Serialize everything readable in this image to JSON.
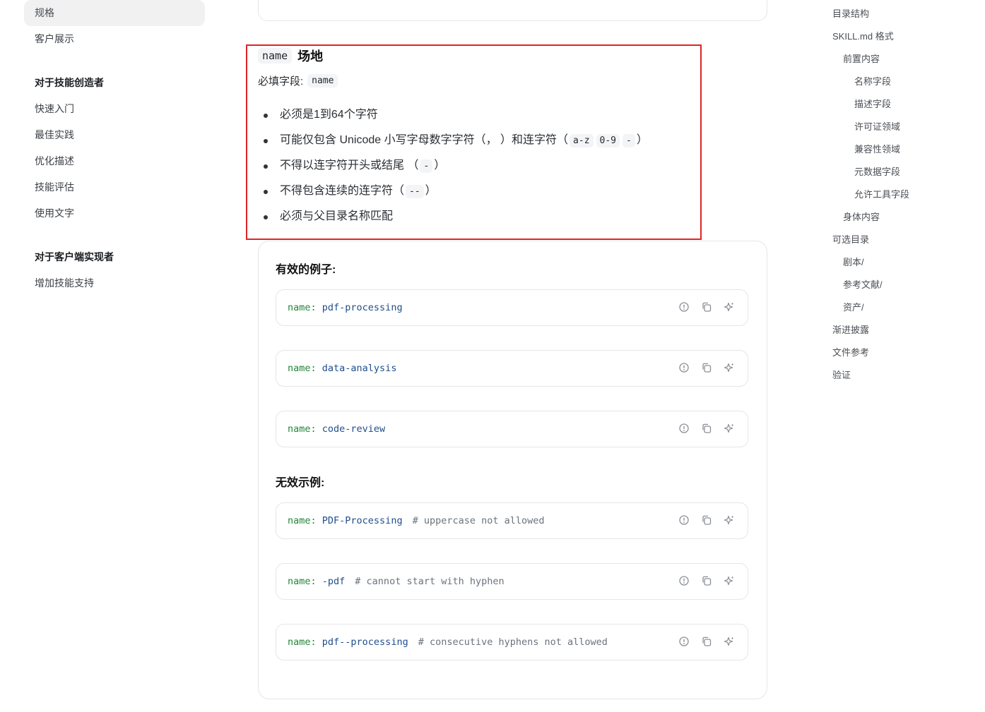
{
  "left_nav": {
    "items_top": [
      "规格",
      "客户展示"
    ],
    "groups": [
      {
        "title": "对于技能创造者",
        "items": [
          "快速入门",
          "最佳实践",
          "优化描述",
          "技能评估",
          "使用文字"
        ]
      },
      {
        "title": "对于客户端实现者",
        "items": [
          "增加技能支持"
        ]
      }
    ]
  },
  "section": {
    "title_code": "name",
    "title_text": "场地",
    "required_label": "必填字段:",
    "required_code": "name",
    "rules": {
      "r1": "必须是1到64个字符",
      "r2_text": "可能仅包含 Unicode 小写字母数字字符（，  ）和连字符（",
      "r2_codes": [
        "a-z",
        "0-9",
        "-"
      ],
      "r2_end": "）",
      "r3_text": "不得以连字符开头或结尾  （",
      "r3_code": "-",
      "r3_end": "）",
      "r4_text": "不得包含连续的连字符（",
      "r4_code": "--",
      "r4_end": "）",
      "r5": "必须与父目录名称匹配"
    }
  },
  "examples": {
    "valid_heading": "有效的例子:",
    "invalid_heading": "无效示例:",
    "valid": [
      {
        "key": "name:",
        "value": "pdf-processing",
        "comment": ""
      },
      {
        "key": "name:",
        "value": "data-analysis",
        "comment": ""
      },
      {
        "key": "name:",
        "value": "code-review",
        "comment": ""
      }
    ],
    "invalid": [
      {
        "key": "name:",
        "value": "PDF-Processing",
        "comment": "# uppercase not allowed"
      },
      {
        "key": "name:",
        "value": "-pdf",
        "comment": "# cannot start with hyphen"
      },
      {
        "key": "name:",
        "value": "pdf--processing",
        "comment": "# consecutive hyphens not allowed"
      }
    ],
    "icons": [
      "info-icon",
      "copy-icon",
      "sparkle-icon"
    ]
  },
  "toc": {
    "items": [
      {
        "label": "目录结构",
        "level": 1
      },
      {
        "label": "SKILL.md 格式",
        "level": 1
      },
      {
        "label": "前置内容",
        "level": 2
      },
      {
        "label": "名称字段",
        "level": 3
      },
      {
        "label": "描述字段",
        "level": 3
      },
      {
        "label": "许可证领域",
        "level": 3
      },
      {
        "label": "兼容性领域",
        "level": 3
      },
      {
        "label": "元数据字段",
        "level": 3
      },
      {
        "label": "允许工具字段",
        "level": 3
      },
      {
        "label": "身体内容",
        "level": 2
      },
      {
        "label": "可选目录",
        "level": 1
      },
      {
        "label": "剧本/",
        "level": 2
      },
      {
        "label": "参考文献/",
        "level": 2
      },
      {
        "label": "资产/",
        "level": 2
      },
      {
        "label": "渐进披露",
        "level": 1
      },
      {
        "label": "文件参考",
        "level": 1
      },
      {
        "label": "验证",
        "level": 1
      }
    ]
  }
}
